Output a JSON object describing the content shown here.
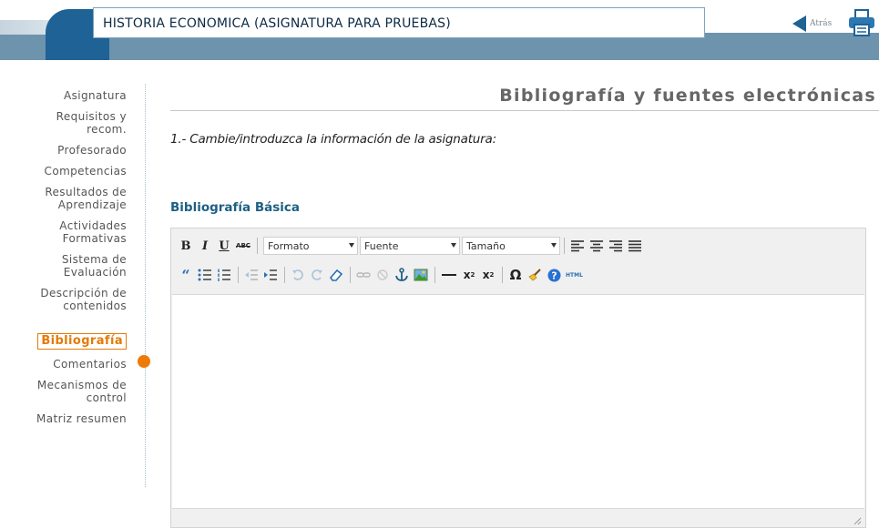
{
  "header": {
    "title": "HISTORIA ECONOMICA (ASIGNATURA PARA PRUEBAS)",
    "back_label": "Atrás"
  },
  "sidebar": {
    "items": [
      {
        "label": "Asignatura"
      },
      {
        "label": "Requisitos y\nrecom."
      },
      {
        "label": "Profesorado"
      },
      {
        "label": "Competencias"
      },
      {
        "label": "Resultados de\nAprendizaje"
      },
      {
        "label": "Actividades\nFormativas"
      },
      {
        "label": "Sistema de\nEvaluación"
      },
      {
        "label": "Descripción de\ncontenidos"
      },
      {
        "label": "Bibliografía",
        "active": true
      },
      {
        "label": "Comentarios"
      },
      {
        "label": "Mecanismos de\ncontrol"
      },
      {
        "label": "Matriz resumen"
      }
    ]
  },
  "main": {
    "page_title": "Bibliografía y fuentes electrónicas",
    "instruction": "1.- Cambie/introduzca la información de la asignatura:",
    "section_heading": "Bibliografía Básica"
  },
  "editor": {
    "format_select": "Formato",
    "font_select": "Fuente",
    "size_select": "Tamaño",
    "bold": "B",
    "italic": "I",
    "underline": "U",
    "strike": "ABC",
    "html_btn": "HTML",
    "content": ""
  },
  "colors": {
    "accent": "#e57a06",
    "brand": "#1f6296",
    "header_band": "#6e93ad",
    "section_heading": "#1d5f84"
  },
  "icons": [
    "back-arrow-icon",
    "printer-icon",
    "blockquote-icon",
    "bullet-list-icon",
    "numbered-list-icon",
    "outdent-icon",
    "indent-icon",
    "undo-icon",
    "redo-icon",
    "eraser-icon",
    "link-icon",
    "unlink-icon",
    "anchor-icon",
    "image-icon",
    "horizontal-rule-icon",
    "subscript-icon",
    "superscript-icon",
    "special-char-icon",
    "paste-cleanup-icon",
    "help-icon"
  ]
}
